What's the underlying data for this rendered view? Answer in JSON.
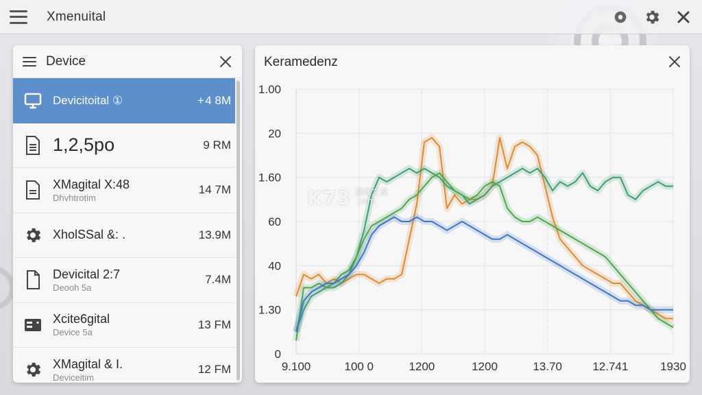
{
  "app": {
    "title": "Xmenuital"
  },
  "device_panel": {
    "title": "Device",
    "items": [
      {
        "name": "Devicitoital ①",
        "sub": "",
        "size": "+ 4 8M",
        "icon": "monitor-icon",
        "selected": true
      },
      {
        "name": "1,2,5po",
        "sub": "",
        "size": "9 RM",
        "icon": "document-icon",
        "selected": false
      },
      {
        "name": "XMagital X:48",
        "sub": "Dhvhtrotim",
        "size": "14 7M",
        "icon": "document-icon",
        "selected": false
      },
      {
        "name": "XholSSal &: .",
        "sub": "",
        "size": "13.9M",
        "icon": "gear-icon",
        "selected": false
      },
      {
        "name": "Devicital 2:7",
        "sub": "Deooh 5a",
        "size": "7.4M",
        "icon": "file-icon",
        "selected": false
      },
      {
        "name": "Xcite6gital",
        "sub": "Device 5a",
        "size": "13 FM",
        "icon": "server-icon",
        "selected": false
      },
      {
        "name": "XMagital & I.",
        "sub": "Deviceitim",
        "size": "12 FM",
        "icon": "gear-icon",
        "selected": false
      }
    ]
  },
  "chart_panel": {
    "title": "Keramedenz"
  },
  "watermark": {
    "logo": "K73",
    "sub_line1": "游戏之家",
    "sub_line2": ".com"
  },
  "chart_data": {
    "type": "line",
    "title": "Keramedenz",
    "xlabel": "",
    "ylabel": "",
    "y_tick_labels": [
      "1.00",
      "20",
      "1.60",
      "60",
      "40",
      "1.30",
      "0"
    ],
    "x_tick_labels": [
      "9.100",
      "100 0",
      "1200",
      "1200",
      "13.70",
      "12.741",
      "1930"
    ],
    "y_domain": [
      0,
      6
    ],
    "x_domain": [
      0,
      100
    ],
    "grid": true,
    "series": [
      {
        "color": "#e08a2e",
        "x": [
          0,
          2,
          4,
          6,
          8,
          10,
          12,
          14,
          16,
          18,
          20,
          22,
          24,
          26,
          28,
          30,
          32,
          34,
          36,
          38,
          40,
          42,
          44,
          46,
          48,
          50,
          52,
          54,
          56,
          58,
          60,
          62,
          64,
          66,
          68,
          70,
          72,
          74,
          76,
          78,
          80,
          82,
          84,
          86,
          88,
          90,
          92,
          94,
          96,
          98,
          100
        ],
        "y": [
          1.3,
          1.8,
          1.7,
          1.8,
          1.6,
          1.7,
          1.6,
          1.7,
          1.8,
          1.8,
          1.7,
          1.6,
          1.7,
          1.7,
          1.8,
          2.6,
          3.4,
          4.8,
          4.9,
          4.7,
          3.3,
          3.6,
          3.4,
          3.5,
          3.5,
          3.6,
          3.8,
          4.9,
          4.2,
          4.7,
          4.8,
          4.7,
          4.5,
          3.8,
          3.1,
          2.6,
          2.4,
          2.2,
          2.0,
          1.9,
          1.8,
          1.7,
          1.6,
          1.6,
          1.4,
          1.2,
          1.1,
          1.0,
          0.9,
          0.8,
          0.8
        ]
      },
      {
        "color": "#3a9e6e",
        "x": [
          0,
          2,
          4,
          6,
          8,
          10,
          12,
          14,
          16,
          18,
          20,
          22,
          24,
          26,
          28,
          30,
          32,
          34,
          36,
          38,
          40,
          42,
          44,
          46,
          48,
          50,
          52,
          54,
          56,
          58,
          60,
          62,
          64,
          66,
          68,
          70,
          72,
          74,
          76,
          78,
          80,
          82,
          84,
          86,
          88,
          90,
          92,
          94,
          96,
          98,
          100
        ],
        "y": [
          0.5,
          1.0,
          1.3,
          1.4,
          1.5,
          1.5,
          1.6,
          1.8,
          2.2,
          2.8,
          3.6,
          4.0,
          3.9,
          4.0,
          4.1,
          4.2,
          4.1,
          4.2,
          4.1,
          4.0,
          3.8,
          3.7,
          3.6,
          3.4,
          3.5,
          3.6,
          3.8,
          3.9,
          4.0,
          4.1,
          4.2,
          4.1,
          4.2,
          4.0,
          3.7,
          3.9,
          3.8,
          3.9,
          4.1,
          3.8,
          3.7,
          3.9,
          4.0,
          4.0,
          3.6,
          3.5,
          3.7,
          3.8,
          3.9,
          3.8,
          3.8
        ]
      },
      {
        "color": "#4aa84a",
        "x": [
          0,
          2,
          4,
          6,
          8,
          10,
          12,
          14,
          16,
          18,
          20,
          22,
          24,
          26,
          28,
          30,
          32,
          34,
          36,
          38,
          40,
          42,
          44,
          46,
          48,
          50,
          52,
          54,
          56,
          58,
          60,
          62,
          64,
          66,
          68,
          70,
          72,
          74,
          76,
          78,
          80,
          82,
          84,
          86,
          88,
          90,
          92,
          94,
          96,
          98,
          100
        ],
        "y": [
          0.3,
          1.5,
          1.5,
          1.6,
          1.5,
          1.6,
          1.8,
          1.9,
          2.2,
          2.6,
          2.9,
          3.0,
          3.1,
          3.2,
          3.3,
          3.5,
          3.6,
          3.8,
          4.0,
          4.1,
          3.9,
          3.7,
          3.6,
          3.5,
          3.6,
          3.8,
          3.9,
          3.8,
          3.3,
          3.1,
          3.0,
          3.0,
          3.1,
          3.0,
          2.9,
          2.8,
          2.7,
          2.6,
          2.5,
          2.4,
          2.3,
          2.2,
          2.0,
          1.8,
          1.6,
          1.4,
          1.2,
          1.0,
          0.8,
          0.7,
          0.6
        ]
      },
      {
        "color": "#3b76c4",
        "x": [
          0,
          2,
          4,
          6,
          8,
          10,
          12,
          14,
          16,
          18,
          20,
          22,
          24,
          26,
          28,
          30,
          32,
          34,
          36,
          38,
          40,
          42,
          44,
          46,
          48,
          50,
          52,
          54,
          56,
          58,
          60,
          62,
          64,
          66,
          68,
          70,
          72,
          74,
          76,
          78,
          80,
          82,
          84,
          86,
          88,
          90,
          92,
          94,
          96,
          98,
          100
        ],
        "y": [
          0.5,
          1.2,
          1.4,
          1.5,
          1.6,
          1.6,
          1.7,
          1.8,
          2.0,
          2.3,
          2.7,
          2.9,
          3.0,
          3.1,
          3.0,
          3.0,
          3.1,
          3.0,
          3.0,
          2.9,
          2.8,
          2.9,
          3.0,
          2.9,
          2.8,
          2.7,
          2.6,
          2.6,
          2.7,
          2.6,
          2.5,
          2.4,
          2.3,
          2.2,
          2.1,
          2.0,
          1.9,
          1.8,
          1.7,
          1.6,
          1.5,
          1.4,
          1.3,
          1.2,
          1.2,
          1.1,
          1.1,
          1.0,
          1.0,
          1.0,
          1.0
        ]
      }
    ]
  }
}
